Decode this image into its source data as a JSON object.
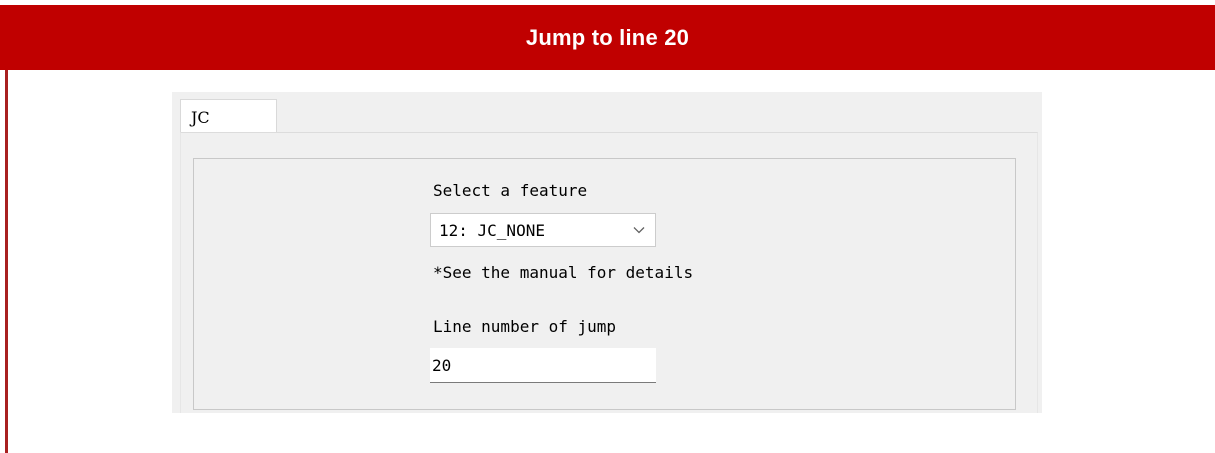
{
  "header": {
    "title": "Jump to line 20",
    "background": "#c00000",
    "text_color": "#ffffff"
  },
  "dialog": {
    "tab": {
      "label": "JC"
    },
    "feature": {
      "label": "Select a feature",
      "selected": "12: JC_NONE",
      "note": "*See the manual for details"
    },
    "jump": {
      "label": "Line number of jump",
      "value": "20"
    }
  }
}
